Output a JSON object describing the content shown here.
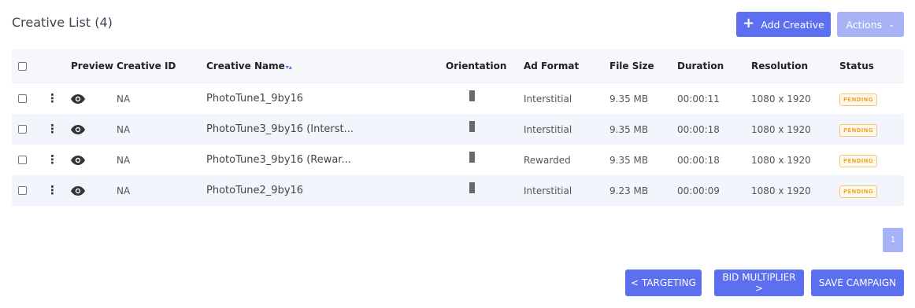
{
  "header": {
    "title": "Creative List (4)",
    "add_label": "Add Creative",
    "add_icon": "plus-icon",
    "actions_label": "Actions",
    "actions_icon": "chevron-down-icon"
  },
  "table": {
    "columns": {
      "preview": "Preview",
      "creative_id": "Creative ID",
      "creative_name": "Creative Name",
      "orientation": "Orientation",
      "ad_format": "Ad Format",
      "file_size": "File Size",
      "duration": "Duration",
      "resolution": "Resolution",
      "status": "Status"
    },
    "rows": [
      {
        "id": "NA",
        "name": "PhotoTune1_9by16",
        "ad_format": "Interstitial",
        "file_size": "9.35 MB",
        "duration": "00:00:11",
        "resolution": "1080 x 1920",
        "status": "PENDING"
      },
      {
        "id": "NA",
        "name": "PhotoTune3_9by16 (Interst...",
        "ad_format": "Interstitial",
        "file_size": "9.35 MB",
        "duration": "00:00:18",
        "resolution": "1080 x 1920",
        "status": "PENDING"
      },
      {
        "id": "NA",
        "name": "PhotoTune3_9by16 (Rewar...",
        "ad_format": "Rewarded",
        "file_size": "9.35 MB",
        "duration": "00:00:18",
        "resolution": "1080 x 1920",
        "status": "PENDING"
      },
      {
        "id": "NA",
        "name": "PhotoTune2_9by16",
        "ad_format": "Interstitial",
        "file_size": "9.23 MB",
        "duration": "00:00:09",
        "resolution": "1080 x 1920",
        "status": "PENDING"
      }
    ]
  },
  "pagination": {
    "current": "1"
  },
  "footer": {
    "targeting_label": "< TARGETING",
    "bid_label": "BID MULTIPLIER >",
    "save_label": "SAVE CAMPAIGN"
  },
  "colors": {
    "accent": "#5b6ff0",
    "accent_light": "#a8b3f7",
    "pending": "#f0a830"
  }
}
